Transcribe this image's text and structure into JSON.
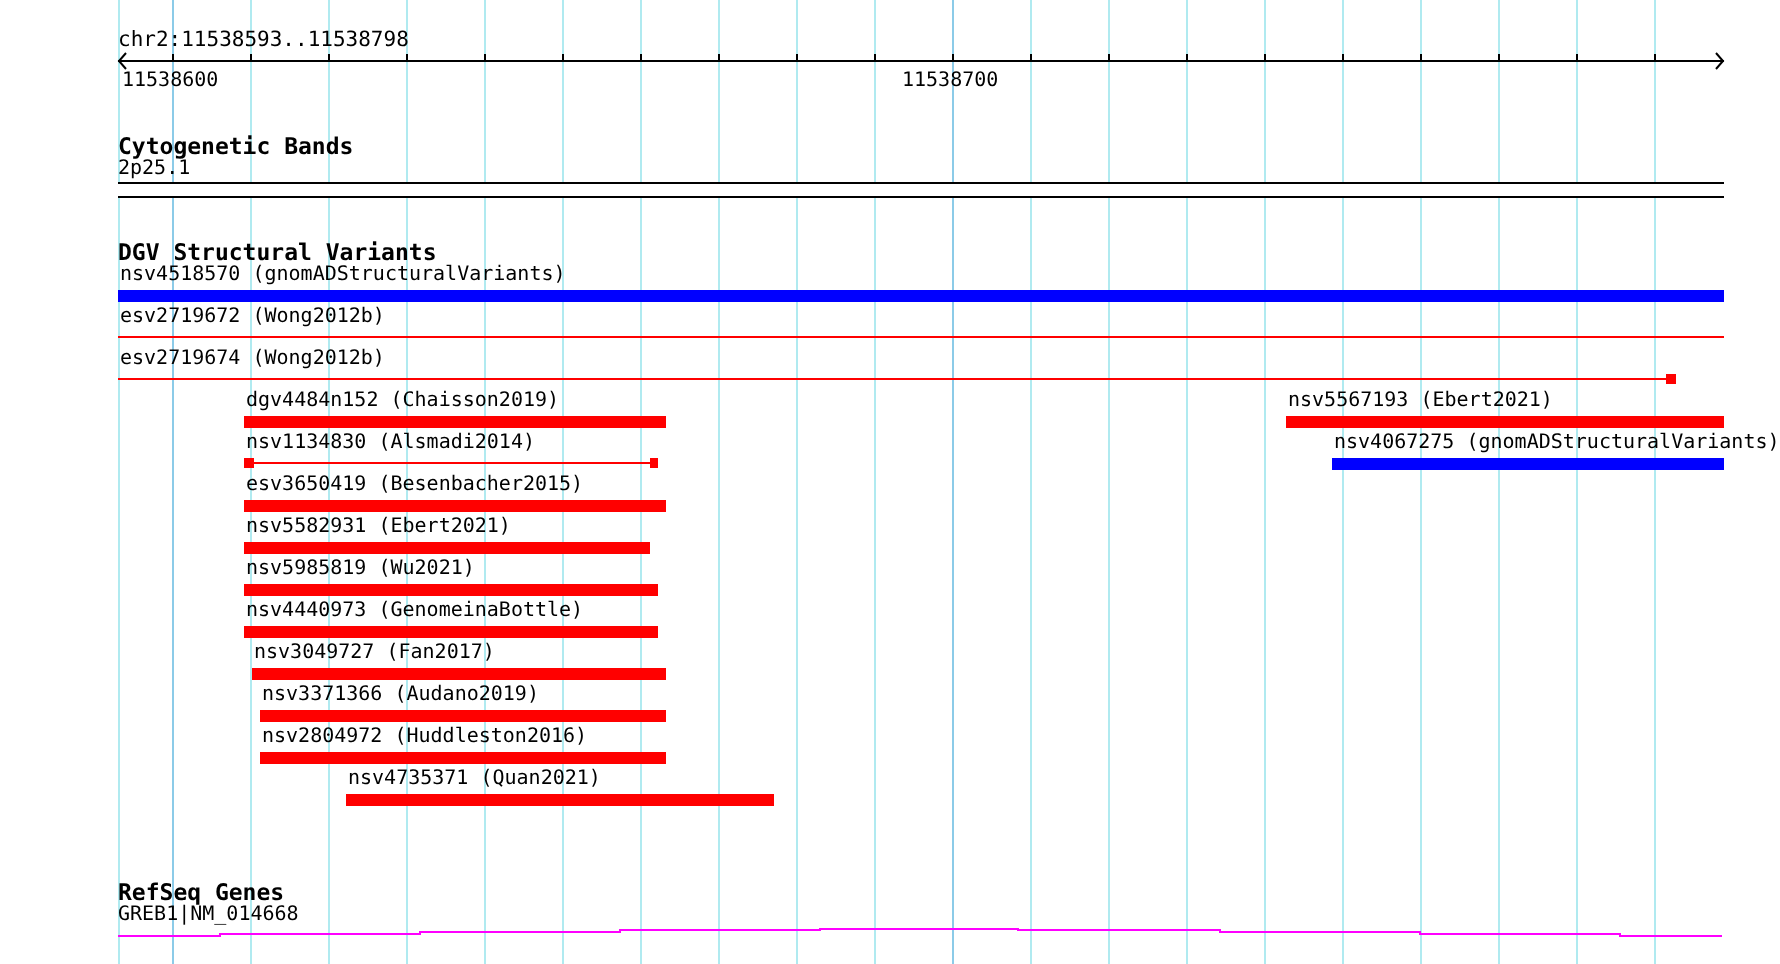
{
  "ruler": {
    "location": "chr2:11538593..11538798",
    "tick_labels": [
      "11538600",
      "11538700"
    ]
  },
  "tracks": [
    {
      "title": "Cytogenetic Bands",
      "kind": "bands",
      "bands": [
        {
          "name": "2p25.1"
        }
      ]
    },
    {
      "title": "DGV Structural Variants",
      "kind": "features",
      "rows": [
        {
          "features": [
            {
              "label": "nsv4518570 (gnomADStructuralVariants)",
              "kind": "bar",
              "color": "#0000ff"
            }
          ]
        },
        {
          "features": [
            {
              "label": "esv2719672 (Wong2012b)",
              "kind": "line",
              "color": "#ff0000"
            }
          ]
        },
        {
          "features": [
            {
              "label": "esv2719674 (Wong2012b)",
              "kind": "gapped",
              "color": "#ff0000"
            }
          ]
        },
        {
          "features": [
            {
              "label": "dgv4484n152 (Chaisson2019)",
              "kind": "bar",
              "color": "#ff0000"
            },
            {
              "label": "nsv5567193 (Ebert2021)",
              "kind": "bar",
              "color": "#ff0000"
            }
          ]
        },
        {
          "features": [
            {
              "label": "nsv1134830 (Alsmadi2014)",
              "kind": "gapped",
              "color": "#ff0000"
            },
            {
              "label": "nsv4067275 (gnomADStructuralVariants)",
              "kind": "bar",
              "color": "#0000ff"
            }
          ]
        },
        {
          "features": [
            {
              "label": "esv3650419 (Besenbacher2015)",
              "kind": "bar",
              "color": "#ff0000"
            }
          ]
        },
        {
          "features": [
            {
              "label": "nsv5582931 (Ebert2021)",
              "kind": "bar",
              "color": "#ff0000"
            }
          ]
        },
        {
          "features": [
            {
              "label": "nsv5985819 (Wu2021)",
              "kind": "bar",
              "color": "#ff0000"
            }
          ]
        },
        {
          "features": [
            {
              "label": "nsv4440973 (GenomeinaBottle)",
              "kind": "bar",
              "color": "#ff0000"
            }
          ]
        },
        {
          "features": [
            {
              "label": "nsv3049727 (Fan2017)",
              "kind": "bar",
              "color": "#ff0000"
            }
          ]
        },
        {
          "features": [
            {
              "label": "nsv3371366 (Audano2019)",
              "kind": "bar",
              "color": "#ff0000"
            }
          ]
        },
        {
          "features": [
            {
              "label": "nsv2804972 (Huddleston2016)",
              "kind": "bar",
              "color": "#ff0000"
            }
          ]
        },
        {
          "features": [
            {
              "label": "nsv4735371 (Quan2021)",
              "kind": "bar",
              "color": "#ff0000"
            }
          ]
        }
      ]
    },
    {
      "title": "RefSeq Genes",
      "kind": "genes",
      "genes": [
        {
          "name": "GREB1|NM_014668"
        }
      ]
    }
  ]
}
